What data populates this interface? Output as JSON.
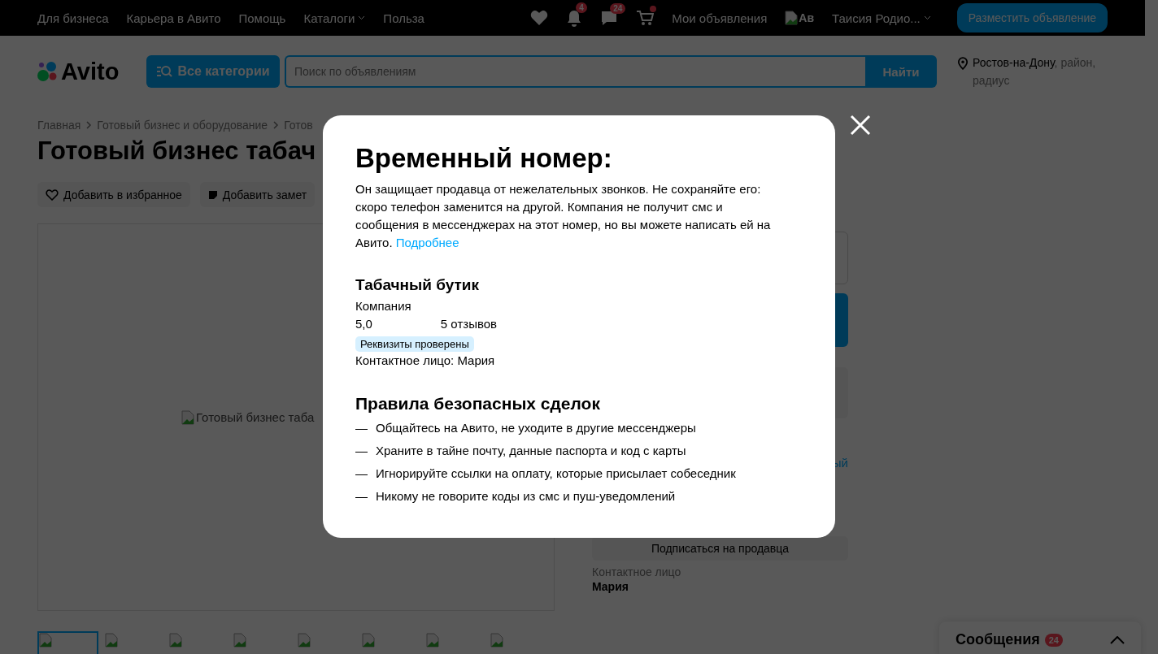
{
  "top_bar": {
    "links": [
      {
        "label": "Для бизнеса",
        "dropdown": false
      },
      {
        "label": "Карьера в Авито",
        "dropdown": false
      },
      {
        "label": "Помощь",
        "dropdown": false
      },
      {
        "label": "Каталоги",
        "dropdown": true
      },
      {
        "label": "Польза",
        "dropdown": false
      }
    ],
    "notifications_badge": "4",
    "messages_badge": "24",
    "cart_dot": true,
    "my_ads": "Мои объявления",
    "avatar_alt": "Ав",
    "user_name": "Таисия Родио...",
    "post_button": "Разместить объявление"
  },
  "header": {
    "logo": "Avito",
    "categories_button": "Все категории",
    "search": {
      "placeholder": "Поиск по объявлениям"
    },
    "search_button": "Найти",
    "city": "Ростов-на-Дону",
    "location_rest": ", район, радиус"
  },
  "breadcrumbs": [
    "Главная",
    "Готовый бизнес и оборудование",
    "Готов"
  ],
  "title": "Готовый бизнес табач",
  "actions": [
    {
      "kind": "favorite",
      "label": "Добавить в избранное"
    },
    {
      "kind": "note",
      "label": "Добавить замет"
    }
  ],
  "image_alt": "Готовый бизнес таба",
  "thumbnails": [
    {
      "selected": true
    },
    {
      "selected": false
    },
    {
      "selected": false
    },
    {
      "selected": false
    },
    {
      "selected": false
    },
    {
      "selected": false
    },
    {
      "selected": false
    },
    {
      "selected": false
    }
  ],
  "sidebar": {
    "link_fragment": "ый",
    "subscribe_button": "Подписаться на продавца",
    "contact_label": "Контактное лицо",
    "contact_name": "Мария"
  },
  "messages_widget": {
    "title": "Сообщения",
    "badge": "24"
  },
  "modal": {
    "title": "Временный номер:",
    "description": "Он защищает продавца от нежелательных звонков. Не сохраняйте его: скоро телефон заменится на другой. Компания не получит смс и сообщения в мессенджерах на этот номер, но вы можете написать ей на Авито.",
    "more_link": "Подробнее",
    "seller": {
      "name": "Табачный бутик",
      "type": "Компания",
      "rating": "5,0",
      "reviews": "5 отзывов",
      "verified_badge": "Реквизиты проверены",
      "contact": "Контактное лицо: Мария"
    },
    "rules_title": "Правила безопасных сделок",
    "rules": [
      {
        "marker": "—",
        "text": "Общайтесь на Авито, не уходите в другие мессенджеры"
      },
      {
        "marker": "—",
        "text": "Храните в тайне почту, данные паспорта и код с карты"
      },
      {
        "marker": "—",
        "text": "Игнорируйте ссылки на оплату, которые присылает собеседник"
      },
      {
        "marker": "—",
        "text": "Никому не говорите коды из смс и пуш-уведомлений"
      }
    ]
  }
}
